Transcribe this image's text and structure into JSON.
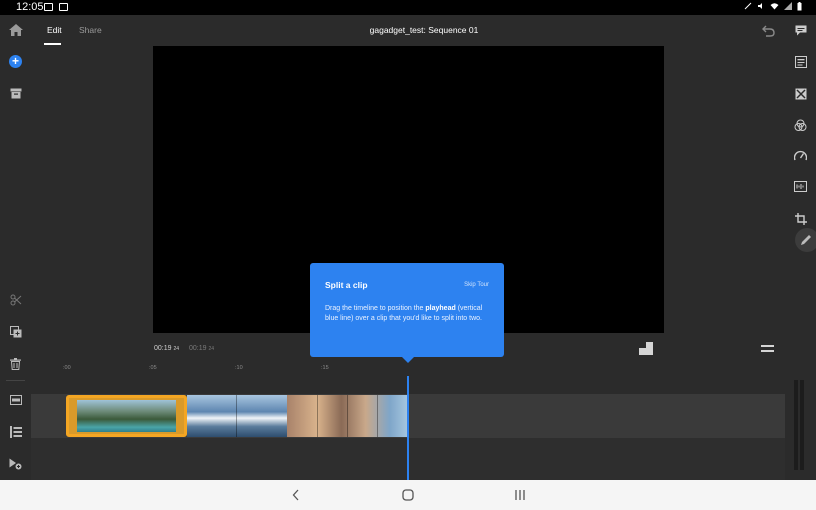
{
  "status_bar": {
    "time": "12:05"
  },
  "header": {
    "tabs": [
      {
        "label": "Edit",
        "active": true
      },
      {
        "label": "Share",
        "active": false
      }
    ],
    "title": "gagadget_test: Sequence 01"
  },
  "left_toolbar": {
    "icons": [
      "home-icon",
      "add-icon",
      "archive-icon",
      "scissors-icon",
      "duplicate-icon",
      "trash-icon",
      "track-icon",
      "list-icon",
      "add-media-icon"
    ]
  },
  "right_toolbar": {
    "icons": [
      "comment-icon",
      "titles-icon",
      "transitions-icon",
      "color-icon",
      "speed-icon",
      "audio-icon",
      "crop-icon",
      "pencil-icon"
    ]
  },
  "player": {
    "current_time": "00:19",
    "current_frame": "24",
    "duration": "00:19",
    "duration_frame": "24"
  },
  "timeline": {
    "ticks": [
      ":00",
      ":05",
      ":10",
      ":15"
    ],
    "clips": [
      {
        "name": "clip-1",
        "selected": true
      },
      {
        "name": "clip-2",
        "selected": false
      },
      {
        "name": "clip-3",
        "selected": false
      }
    ]
  },
  "tooltip": {
    "title": "Split a clip",
    "skip": "Skip Tour",
    "body_before": "Drag the timeline to position the ",
    "body_bold": "playhead",
    "body_after": " (vertical blue line) over a clip that you'd like to split into two."
  },
  "colors": {
    "accent": "#2d82f0",
    "selection": "#f4a623",
    "background": "#2b2b2b"
  }
}
